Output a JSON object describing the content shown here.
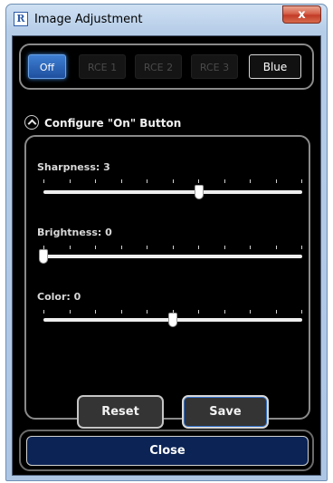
{
  "window": {
    "title": "Image Adjustment",
    "app_icon_letter": "R",
    "close_glyph": "x"
  },
  "modes": {
    "buttons": [
      {
        "label": "Off",
        "state": "selected"
      },
      {
        "label": "RCE 1",
        "state": "disabled"
      },
      {
        "label": "RCE 2",
        "state": "disabled"
      },
      {
        "label": "RCE 3",
        "state": "disabled"
      },
      {
        "label": "Blue",
        "state": "enabled"
      }
    ]
  },
  "configure": {
    "label": "Configure \"On\" Button",
    "icon": "chevron-up-icon"
  },
  "sliders": [
    {
      "name": "sharpness",
      "label": "Sharpness: 3",
      "value_fraction": 0.6
    },
    {
      "name": "brightness",
      "label": "Brightness: 0",
      "value_fraction": 0.0
    },
    {
      "name": "color",
      "label": "Color: 0",
      "value_fraction": 0.5
    }
  ],
  "actions": {
    "reset_label": "Reset",
    "save_label": "Save",
    "close_label": "Close"
  },
  "colors": {
    "selected_mode": "#2b68bd",
    "close_button": "#0b2355"
  }
}
